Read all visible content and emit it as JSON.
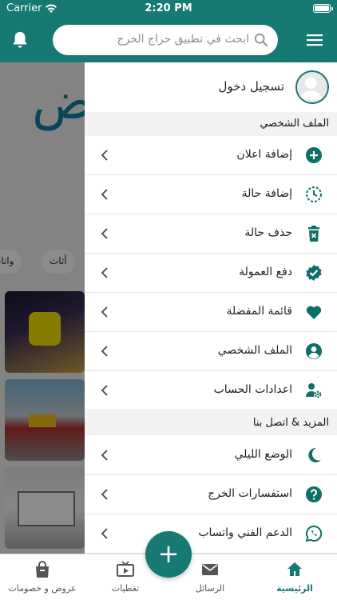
{
  "status_bar": {
    "carrier": "Carrier",
    "time": "2:20 PM"
  },
  "header": {
    "search_placeholder": "ابحث في تطبيق حراج الخرج"
  },
  "drawer": {
    "login_label": "تسجيل دخول",
    "sections": [
      {
        "title": "الملف الشخصي"
      },
      {
        "title": "المزيد & اتصل بنا"
      }
    ],
    "items": [
      {
        "label": "إضافة اعلان",
        "icon": "plus-circle-icon"
      },
      {
        "label": "إضافة حالة",
        "icon": "clock-icon"
      },
      {
        "label": "حذف حالة",
        "icon": "trash-icon"
      },
      {
        "label": "دفع العمولة",
        "icon": "verified-badge-icon"
      },
      {
        "label": "قائمة المفضلة",
        "icon": "heart-icon"
      },
      {
        "label": "الملف الشخصي",
        "icon": "account-circle-icon"
      },
      {
        "label": "اعدادات الحساب",
        "icon": "user-settings-icon"
      },
      {
        "label": "الوضع الليلي",
        "icon": "moon-icon"
      },
      {
        "label": "استفسارات الخرج",
        "icon": "help-icon"
      },
      {
        "label": "الدعم الفني واتساب",
        "icon": "whatsapp-icon"
      }
    ]
  },
  "background": {
    "chip_label": "أثاث",
    "chip_partial": "وانات"
  },
  "tab_bar": {
    "tabs": [
      {
        "label": "الرئيسية",
        "icon": "home-icon",
        "active": true
      },
      {
        "label": "الرسائل",
        "icon": "mail-icon",
        "active": false
      },
      {
        "label": "تغطيات",
        "icon": "video-icon",
        "active": false
      },
      {
        "label": "عروض و خصومات",
        "icon": "shopping-bag-icon",
        "active": false
      }
    ]
  },
  "colors": {
    "primary": "#167a72",
    "accent": "#0e6f68"
  }
}
